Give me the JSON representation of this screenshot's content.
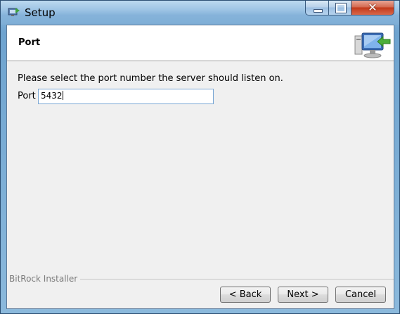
{
  "window": {
    "title": "Setup",
    "controls": {
      "minimize": "minimize",
      "maximize": "maximize",
      "close": "✕"
    }
  },
  "header": {
    "title": "Port",
    "icon": "computer-network-icon"
  },
  "main": {
    "instruction": "Please select the port number the server should listen on.",
    "port_label": "Port",
    "port_value": "5432"
  },
  "footer": {
    "brand": "BitRock Installer",
    "back_label": "< Back",
    "next_label": "Next >",
    "cancel_label": "Cancel"
  },
  "colors": {
    "titlebar": "#86b3da",
    "close_button": "#c2391a",
    "client_bg": "#f0f0f0",
    "input_border": "#7aa7d4"
  }
}
